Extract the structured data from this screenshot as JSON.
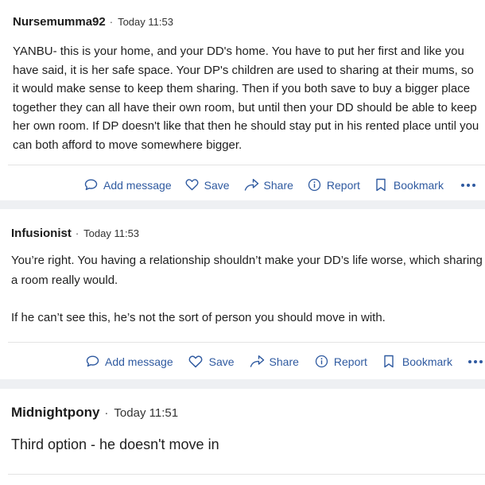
{
  "posts": [
    {
      "username": "Nursemumma92",
      "separator": "·",
      "timestamp": "Today 11:53",
      "body": [
        "YANBU- this is your home, and your DD's home. You have to put her first and like you have said, it is her safe space. Your DP's children are used to sharing at their mums, so it would make sense to keep them sharing. Then if you both save to buy a bigger place together they can all have their own room, but until then your DD should be able to keep her own room. If DP doesn't like that then he should stay put in his rented place until you can both afford to move somewhere bigger."
      ]
    },
    {
      "username": "Infusionist",
      "separator": "·",
      "timestamp": "Today 11:53",
      "body": [
        "You’re right. You having a relationship shouldn’t make your DD’s life worse, which sharing a room really would.",
        "If he can’t see this, he’s not the sort of person you should move in with."
      ]
    },
    {
      "username": "Midnightpony",
      "separator": "·",
      "timestamp": "Today 11:51",
      "body": [
        "Third option - he doesn't move in"
      ]
    }
  ],
  "actions": {
    "add_message": "Add message",
    "save": "Save",
    "share": "Share",
    "report": "Report",
    "bookmark": "Bookmark"
  },
  "icons": {
    "add_message": "speech-bubble-icon",
    "save": "heart-icon",
    "share": "share-arrow-icon",
    "report": "info-circle-icon",
    "bookmark": "bookmark-icon",
    "more": "more-dots-icon"
  },
  "colors": {
    "action_text": "#2f5aa0",
    "background": "#eef0f3",
    "card": "#ffffff"
  }
}
